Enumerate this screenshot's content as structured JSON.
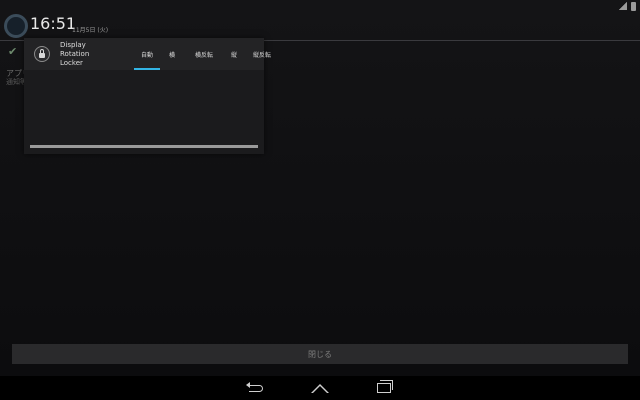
{
  "status_bar": {
    "time": "16:51",
    "date": "11月5日 (火)",
    "signal_icon": "signal-icon",
    "battery_icon": "battery-icon"
  },
  "background_app": {
    "icon": "app-launcher-icon",
    "check_icon": "checkmark-icon",
    "text_line_1": "アプリ",
    "text_line_2": "通知等"
  },
  "notification": {
    "app_icon": "lock-icon",
    "app_name": "Display\nRotation\nLocker",
    "tabs": [
      {
        "label": "自動",
        "active": true
      },
      {
        "label": "横",
        "active": false
      },
      {
        "label": "横反転",
        "active": false
      },
      {
        "label": "縦",
        "active": false
      },
      {
        "label": "縦反転",
        "active": false
      }
    ],
    "progress": 1.0,
    "accent_color": "#33b5e5"
  },
  "close_button": {
    "label": "閉じる"
  },
  "nav_bar": {
    "back_icon": "back-icon",
    "home_icon": "home-icon",
    "recents_icon": "recents-icon"
  }
}
